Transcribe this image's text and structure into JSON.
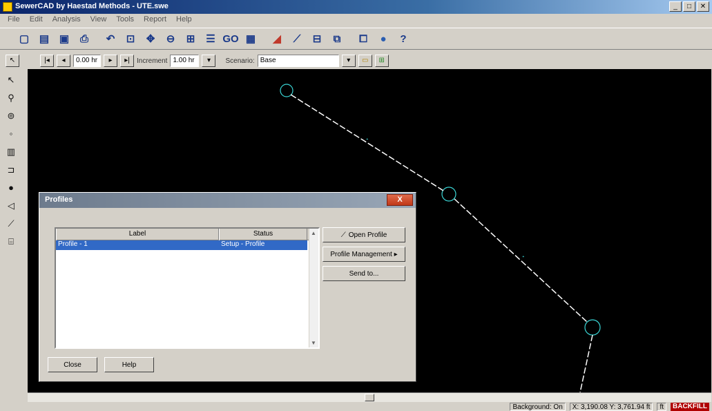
{
  "window": {
    "title": "SewerCAD by Haestad Methods - UTE.swe",
    "buttons": [
      "_",
      "□",
      "✕"
    ]
  },
  "menu": [
    "File",
    "Edit",
    "Analysis",
    "View",
    "Tools",
    "Report",
    "Help"
  ],
  "toolbar": {
    "icons": [
      "new-icon",
      "open-icon",
      "save-icon",
      "print-icon",
      "undo-icon",
      "zoom-window-icon",
      "pan-icon",
      "zoom-previous-icon",
      "zoom-extents-icon",
      "report-icon",
      "go-icon",
      "calendar-icon",
      "color-code-icon",
      "profile-icon",
      "annotation-icon",
      "flex-tables-icon",
      "global-edit-icon",
      "help-icon"
    ],
    "go_label": "GO",
    "help_label": "?"
  },
  "toolbar2": {
    "time_value": "0.00 hr",
    "increment_label": "Increment",
    "increment_value": "1.00 hr",
    "scenario_label": "Scenario:",
    "scenario_value": "Base"
  },
  "left_tools": [
    "select-icon",
    "manhole-icon",
    "pump-icon",
    "wet-well-icon",
    "junction-icon",
    "outlet-icon",
    "node-icon",
    "triangle-icon",
    "pipe-icon",
    "layout-icon"
  ],
  "dialog": {
    "title": "Profiles",
    "close_label": "X",
    "columns": [
      "Label",
      "Status"
    ],
    "rows": [
      {
        "label": "Profile - 1",
        "status": "Setup - Profile"
      }
    ],
    "side_buttons": {
      "open": "Open Profile",
      "management": "Profile Management ▸",
      "send_to": "Send to..."
    },
    "bottom_buttons": {
      "close": "Close",
      "help": "Help"
    }
  },
  "status": {
    "background": "Background: On",
    "coords": "X: 3,190.08  Y: 3,761.94 ft",
    "unit": "ft",
    "badge": "BACKFILL"
  },
  "colors": {
    "canvas": "#000000",
    "network": "#3ad6d6",
    "selection": "#3169c6"
  }
}
